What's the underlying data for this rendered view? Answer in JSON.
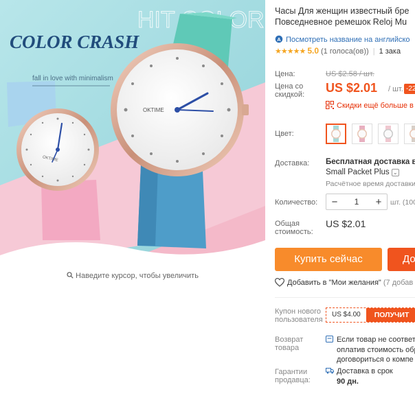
{
  "product": {
    "title_line1": "Часы Для женщин известный бре",
    "title_line2": "Повседневное ремешок Reloj Mu",
    "translate_link": "Посмотреть название на английско",
    "rating_stars": 5,
    "rating_value": "5.0",
    "rating_votes": "(1 голоса(ов))",
    "orders": "1 зака"
  },
  "image": {
    "banner_text": "COLOR CRASH",
    "bg_text": "HIT COLOR",
    "tagline": "fall in love with minimalism",
    "watch_brand": "OKTIME",
    "zoom_hint": "Наведите курсор, чтобы увеличить"
  },
  "pricing": {
    "price_label": "Цена:",
    "old_price": "US $2.58 / шт.",
    "discount_label_1": "Цена со",
    "discount_label_2": "скидкой:",
    "price": "US $2.01",
    "per_unit": "/ шт.",
    "discount_badge": "-22",
    "promo_text": "Скидки ещё больше в п"
  },
  "options": {
    "color_label": "Цвет:",
    "swatches": [
      {
        "color": "#a8d8d6",
        "selected": true
      },
      {
        "color": "#e8b0c0",
        "selected": false
      },
      {
        "color": "#f0c8d0",
        "selected": false
      },
      {
        "color": "#d8d0c8",
        "selected": false
      }
    ]
  },
  "shipping": {
    "label": "Доставка:",
    "line1": "Бесплатная доставка в R",
    "line2": "Small Packet Plus",
    "line3": "Расчётное время доставки"
  },
  "quantity": {
    "label": "Количество:",
    "value": "1",
    "minus": "−",
    "plus": "+",
    "unit_text": "шт. (100"
  },
  "total": {
    "label_1": "Общая",
    "label_2": "стоимость:",
    "value": "US $2.01"
  },
  "actions": {
    "buy_now": "Купить сейчас",
    "add_to_cart": "До",
    "wishlist": "Добавить в \"Мои желания\"",
    "wishlist_count": "(7 добав"
  },
  "coupon": {
    "label_1": "Купон нового",
    "label_2": "пользователя",
    "amount": "US $4.00",
    "get": "ПОЛУЧИТ"
  },
  "returns": {
    "label_1": "Возврат",
    "label_2": "товара",
    "line1": "Если товар не соответ",
    "line2": "оплатив стоимость обр",
    "line3": "договориться о компе"
  },
  "guarantee": {
    "label_1": "Гарантии",
    "label_2": "продавца:",
    "line1": "Доставка в срок",
    "line2": "90 дн."
  },
  "colors": {
    "accent": "#f0541e",
    "buy_button": "#f88b2b",
    "link": "#2f6fb6",
    "star": "#f5a623"
  }
}
